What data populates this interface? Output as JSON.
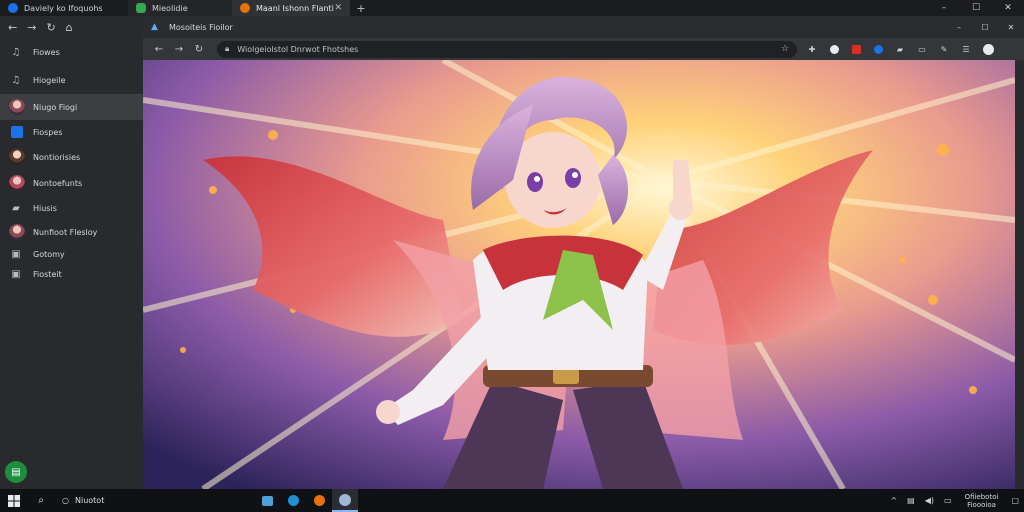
{
  "tabs": [
    {
      "title": "Daviely ko Ifoquohs",
      "favicon_color": "#1a73e8",
      "active": false
    },
    {
      "title": "Mieolidie",
      "favicon_color": "#34a853",
      "active": false
    },
    {
      "title": "Maanl Ishonn Flanti",
      "favicon_color": "#e8710a",
      "active": true
    }
  ],
  "window_controls": {
    "minimize": "–",
    "maximize": "☐",
    "close": "✕"
  },
  "sidebar": {
    "nav": {
      "back": "←",
      "forward": "→",
      "reload": "↻",
      "home": "⌂"
    },
    "items": [
      {
        "label": "Fiowes",
        "icon": "music-icon",
        "type": "icon"
      },
      {
        "label": "Hiogeile",
        "icon": "music-icon",
        "type": "icon"
      },
      {
        "label": "Niugo Fiogi",
        "icon": "avatar",
        "type": "avatar",
        "active": true
      },
      {
        "label": "Fiospes",
        "icon": "app-icon",
        "type": "square",
        "color": "#1a73e8"
      },
      {
        "label": "Nontiorisies",
        "icon": "avatar",
        "type": "avatar"
      },
      {
        "label": "Nontoefunts",
        "icon": "avatar",
        "type": "avatar"
      },
      {
        "label": "Hiusis",
        "icon": "folder-icon",
        "type": "icon"
      },
      {
        "label": "Nunfioot Flesloy",
        "icon": "avatar",
        "type": "avatar"
      },
      {
        "label": "Gotomy",
        "icon": "gamepad-icon",
        "type": "icon"
      },
      {
        "label": "Fiosteit",
        "icon": "gamepad-icon",
        "type": "icon"
      }
    ],
    "fab_icon": "book-icon"
  },
  "inner_window": {
    "title": "Mosoiteis Fioilor",
    "controls": {
      "minimize": "–",
      "maximize": "☐",
      "close": "✕"
    },
    "toolbar": {
      "back": "←",
      "forward": "→",
      "reload": "↻"
    },
    "url": "Wiolgeiolstol Dnrwot Fhotshes"
  },
  "taskbar": {
    "search_label": "Niuotot",
    "tray": {
      "chevron": "^",
      "clock_line1": "Ofiiebotoi",
      "clock_line2": "Fioooioa"
    }
  },
  "colors": {
    "accent": "#8ab4f8",
    "sidebar_bg": "#292a2d",
    "taskbar_bg": "#101114"
  }
}
